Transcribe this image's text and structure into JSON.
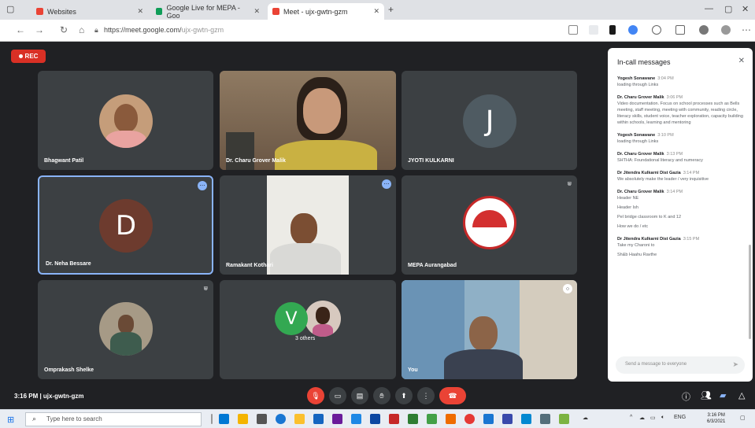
{
  "browser": {
    "tabs": [
      {
        "label": "Websites",
        "color": "#ea4335"
      },
      {
        "label": "Google Live for MEPA - Goo",
        "color": "#0f9d58"
      },
      {
        "label": "Meet - ujx-gwtn-gzm",
        "color": "#ea4335"
      }
    ],
    "url_domain": "https://meet.google.com/",
    "url_path": "ujx-gwtn-gzm"
  },
  "meet": {
    "rec_label": "REC",
    "meeting_time": "3:16 PM",
    "meeting_code": "ujx-gwtn-gzm",
    "participants": [
      {
        "name": "Bhagwant Patil",
        "avatar": "photo"
      },
      {
        "name": "Dr. Charu Grover Malik",
        "avatar": "video"
      },
      {
        "name": "JYOTI KULKARNI",
        "avatar": "J",
        "avatar_color": "#4f5b62"
      },
      {
        "name": "Dr. Neha Bessare",
        "avatar": "D",
        "avatar_color": "#6d3b2e"
      },
      {
        "name": "Ramakant Kothari",
        "avatar": "video"
      },
      {
        "name": "MEPA Aurangabad",
        "avatar": "logo"
      },
      {
        "name": "Omprakash Shelke",
        "avatar": "photo"
      },
      {
        "name": "3 others",
        "avatar": "V",
        "avatar_color": "#33a852"
      },
      {
        "name": "You",
        "avatar": "video"
      }
    ]
  },
  "chat": {
    "title": "In-call messages",
    "input_placeholder": "Send a message to everyone",
    "messages": [
      {
        "who": "Yogesh Sonawane",
        "time": "3:04 PM",
        "text": "loading through Links"
      },
      {
        "who": "Dr. Charu Grover Malik",
        "time": "3:06 PM",
        "text": "Video documentation. Focus on school processes such as Bells meeting, staff meeting, meeting with community, reading circle, literacy skills, student voice, teacher exploration, capacity building within schools, learning and mentoring"
      },
      {
        "who": "Yogesh Sonawane",
        "time": "3:10 PM",
        "text": "loading through Links"
      },
      {
        "who": "Dr. Charu Grover Malik",
        "time": "3:13 PM",
        "text": "SHTHA: Foundational literacy and numeracy"
      },
      {
        "who": "Dr Jitendra Kulkarni Dist Gazia",
        "time": "3:14 PM",
        "text": "We absolutely make the leader / very inquisitive"
      },
      {
        "who": "Dr. Charu Grover Malik",
        "time": "3:14 PM",
        "text": "Header NE"
      },
      {
        "who": "",
        "time": "",
        "text": "Header Ish"
      },
      {
        "who": "",
        "time": "",
        "text": "Pel bridge classroom to K and 12"
      },
      {
        "who": "",
        "time": "",
        "text": "How we do / etc"
      },
      {
        "who": "Dr Jitendra Kulkarni Dist Gazia",
        "time": "3:15 PM",
        "text": "Take my Charoni to"
      },
      {
        "who": "",
        "time": "",
        "text": "Sh&b Haahu Ravthe"
      }
    ]
  },
  "taskbar": {
    "search_placeholder": "Type here to search",
    "time": "3:16 PM",
    "date": "6/3/2021"
  }
}
